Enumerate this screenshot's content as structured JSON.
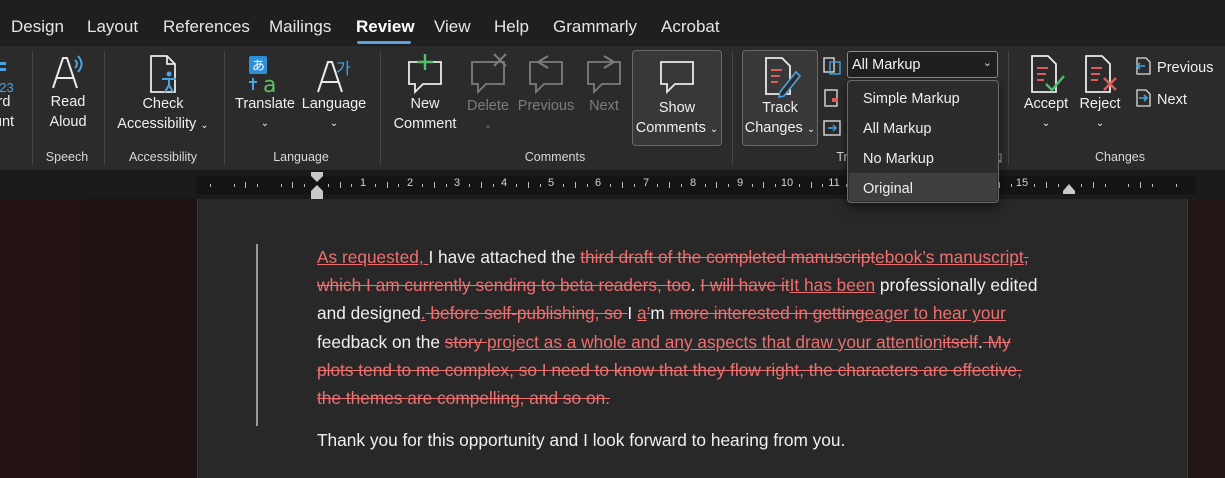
{
  "menu": {
    "tabs": [
      "Design",
      "Layout",
      "References",
      "Mailings",
      "Review",
      "View",
      "Help",
      "Grammarly",
      "Acrobat"
    ],
    "active": "Review"
  },
  "ribbon": {
    "partial_left": {
      "line1": "rd",
      "line2": "unt"
    },
    "read_aloud": {
      "line1": "Read",
      "line2": "Aloud"
    },
    "check_accessibility": {
      "line1": "Check",
      "line2": "Accessibility"
    },
    "translate": "Translate",
    "language": "Language",
    "new_comment": {
      "line1": "New",
      "line2": "Comment"
    },
    "delete": "Delete",
    "previous_comment": "Previous",
    "next_comment": "Next",
    "show_comments": {
      "line1": "Show",
      "line2": "Comments"
    },
    "track_changes": {
      "line1": "Track",
      "line2": "Changes"
    },
    "accept": "Accept",
    "reject": "Reject",
    "previous_change": "Previous",
    "next_change": "Next",
    "groups": {
      "speech": "Speech",
      "accessibility": "Accessibility",
      "language": "Language",
      "comments": "Comments",
      "tracking_partial": "Tr",
      "changes": "Changes"
    },
    "markup_select": {
      "value": "All Markup",
      "options": [
        "Simple Markup",
        "All Markup",
        "No Markup",
        "Original"
      ],
      "highlighted": "Original"
    }
  },
  "ruler": {
    "numbers": [
      "1",
      "2",
      "3",
      "4",
      "5",
      "6",
      "7",
      "8",
      "9",
      "10",
      "11",
      "15"
    ]
  },
  "document": {
    "paragraph1": [
      {
        "t": "ins",
        "s": "As requested, "
      },
      {
        "t": "n",
        "s": "I have attached the "
      },
      {
        "t": "del",
        "s": "third draft of the completed manuscript"
      },
      {
        "t": "ins",
        "s": "ebook’s manuscript"
      },
      {
        "t": "del",
        "s": ", which I am currently sending to beta readers, too"
      },
      {
        "t": "n",
        "s": ". "
      },
      {
        "t": "del",
        "s": "I will have it"
      },
      {
        "t": "ins",
        "s": "It has been"
      },
      {
        "t": "n",
        "s": " professionally edited and designed"
      },
      {
        "t": "ins",
        "s": "."
      },
      {
        "t": "del",
        "s": " before self-publishing, so "
      },
      {
        "t": "n",
        "s": "I "
      },
      {
        "t": "ins",
        "s": "a"
      },
      {
        "t": "del",
        "s": "’"
      },
      {
        "t": "n",
        "s": "m "
      },
      {
        "t": "del",
        "s": "more interested in getting"
      },
      {
        "t": "ins",
        "s": "eager to hear your"
      },
      {
        "t": "n",
        "s": " feedback on the "
      },
      {
        "t": "del",
        "s": "story "
      },
      {
        "t": "ins",
        "s": "project as a whole and any aspects that draw your attention"
      },
      {
        "t": "del",
        "s": "itself"
      },
      {
        "t": "n",
        "s": "."
      },
      {
        "t": "del",
        "s": " My plots tend to me complex, so I need to know that they flow right, the characters are effective, the themes are compelling, and so on."
      }
    ],
    "paragraph2": "Thank you for this opportunity and I look forward to hearing from you."
  },
  "colors": {
    "accent": "#5aa2e0",
    "markup_red": "#ee6f6f",
    "ribbon_bg": "#2b2b2b",
    "page_bg": "#282828"
  }
}
